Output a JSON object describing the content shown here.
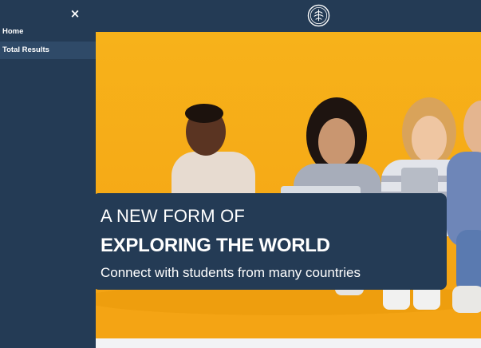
{
  "sidebar": {
    "close_label": "×",
    "items": [
      {
        "label": "Home"
      },
      {
        "label": "Total Results"
      }
    ]
  },
  "hero": {
    "line1": "A NEW FORM OF",
    "line2": "EXPLORING THE WORLD",
    "line3": "Connect with students from many countries"
  },
  "icons": {
    "logo": "circular-seal-logo",
    "close": "close-icon"
  },
  "colors": {
    "navy": "#243b55",
    "hero_yellow": "#f7b21a"
  }
}
